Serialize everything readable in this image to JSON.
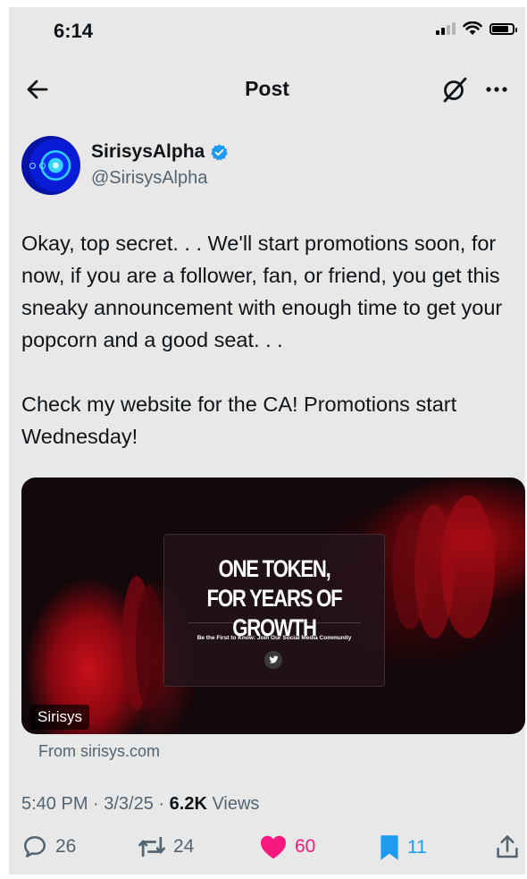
{
  "status_bar": {
    "time": "6:14"
  },
  "header": {
    "title": "Post"
  },
  "author": {
    "name": "SirisysAlpha",
    "handle": "@SirisysAlpha",
    "verified": true
  },
  "post": {
    "text": "Okay, top secret. . .  We'll start promotions soon, for now, if you are a follower, fan, or friend, you get this sneaky announcement with enough time to get your popcorn and a good seat. . .\n\nCheck  my website for the CA! Promotions start Wednesday!"
  },
  "card": {
    "headline": "ONE TOKEN,\nFOR YEARS OF GROWTH",
    "subtext": "Be the First to Know: Join Our Social Media Community",
    "badge": "Sirisys",
    "source": "From sirisys.com"
  },
  "meta": {
    "timestamp": "5:40 PM · 3/3/25 · ",
    "views_count": "6.2K",
    "views_label": " Views"
  },
  "actions": {
    "replies": "26",
    "reposts": "24",
    "likes": "60",
    "bookmarks": "11"
  },
  "colors": {
    "accent_blue": "#1d9bf0",
    "like_pink": "#f91880",
    "muted_text": "#536471",
    "background": "#e8e8e8"
  },
  "icons": [
    "back-arrow-icon",
    "grok-icon",
    "more-icon",
    "verified-badge-icon",
    "reply-icon",
    "repost-icon",
    "like-icon",
    "bookmark-icon",
    "share-icon",
    "twitter-bird-icon"
  ]
}
